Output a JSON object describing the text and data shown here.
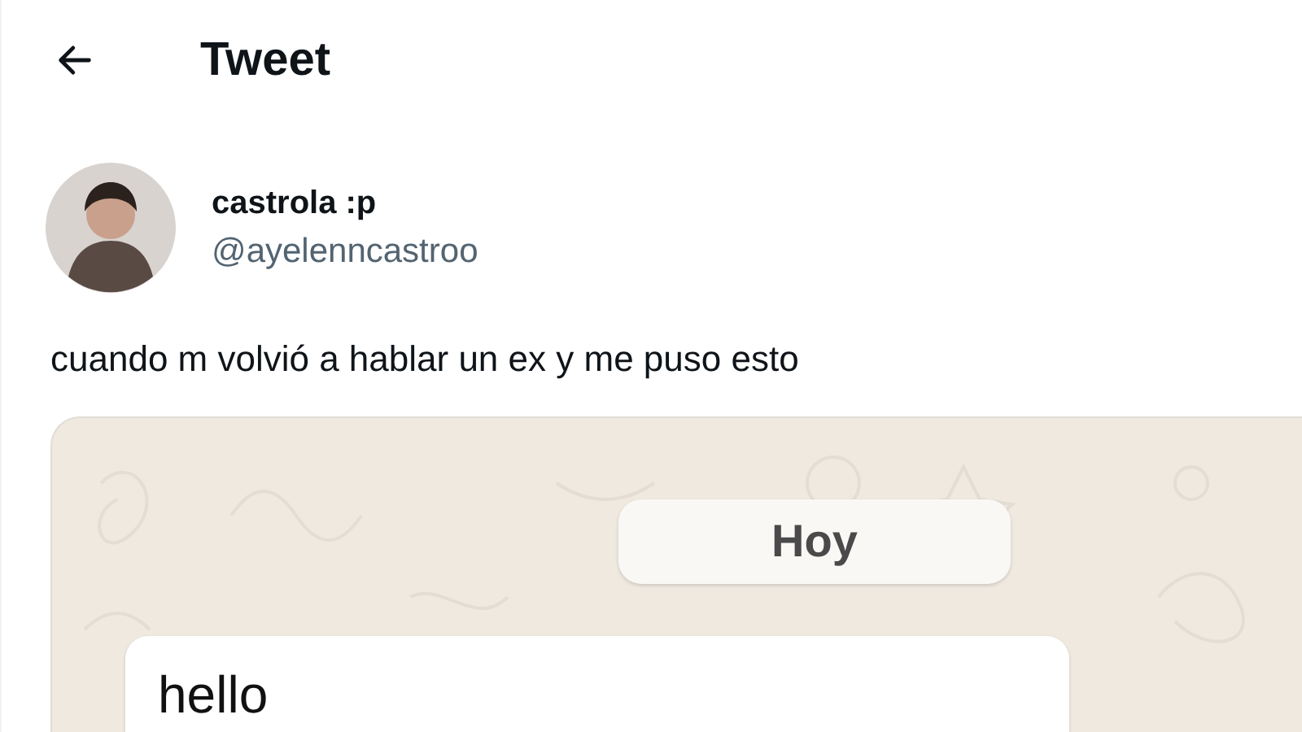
{
  "header": {
    "title": "Tweet"
  },
  "tweet": {
    "author": {
      "name": "castrola :p",
      "handle": "@ayelenncastroo"
    },
    "text": "cuando m volvió a hablar un ex y me puso esto",
    "media": {
      "date_label": "Hoy",
      "messages": [
        {
          "text": "hello"
        }
      ]
    }
  }
}
